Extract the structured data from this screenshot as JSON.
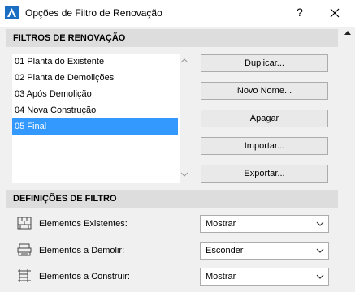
{
  "window": {
    "title": "Opções de Filtro de Renovação",
    "help_label": "?",
    "app_icon": "archicad-logo-icon",
    "close_icon": "close-icon"
  },
  "filters_section": {
    "header": "FILTROS DE RENOVAÇÃO",
    "items": [
      {
        "label": "01 Planta do Existente",
        "selected": false
      },
      {
        "label": "02 Planta de Demolições",
        "selected": false
      },
      {
        "label": "03 Após Demolição",
        "selected": false
      },
      {
        "label": "04 Nova Construção",
        "selected": false
      },
      {
        "label": "05 Final",
        "selected": true
      }
    ],
    "buttons": {
      "duplicate": "Duplicar...",
      "new_name": "Novo Nome...",
      "delete": "Apagar",
      "import": "Importar...",
      "export": "Exportar..."
    }
  },
  "definitions_section": {
    "header": "DEFINIÇÕES DE FILTRO",
    "rows": [
      {
        "label": "Elementos Existentes:",
        "value": "Mostrar",
        "icon": "existing-wall-icon"
      },
      {
        "label": "Elementos a Demolir:",
        "value": "Esconder",
        "icon": "demolish-icon"
      },
      {
        "label": "Elementos a Construir:",
        "value": "Mostrar",
        "icon": "new-construction-icon"
      }
    ]
  },
  "colors": {
    "selection": "#3399ff",
    "section_header": "#dddddd",
    "window_bg": "#f0f0f0"
  }
}
